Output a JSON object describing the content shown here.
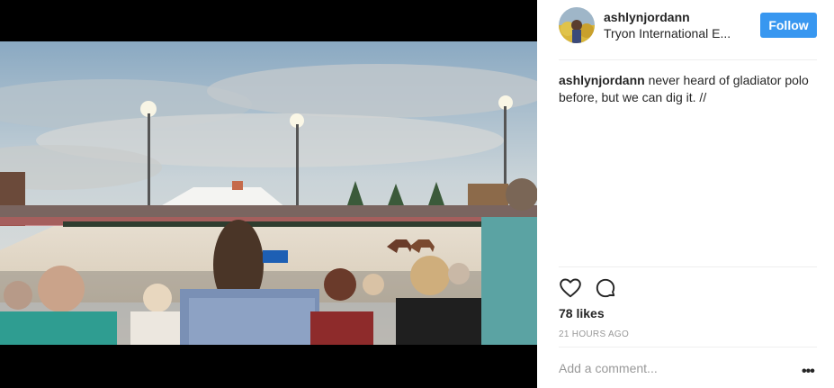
{
  "post": {
    "username": "ashlynjordann",
    "location": "Tryon International E...",
    "follow_label": "Follow",
    "caption_user": "ashlynjordann",
    "caption_text": " never heard of gladiator polo before, but we can dig it. //",
    "likes": "78 likes",
    "timestamp": "21 HOURS AGO",
    "comment_placeholder": "Add a comment...",
    "more_label": "•••"
  },
  "colors": {
    "follow_button": "#3897f0",
    "text": "#262626",
    "muted": "#999999"
  },
  "icons": [
    "heart-icon",
    "comment-icon",
    "more-options-icon"
  ]
}
